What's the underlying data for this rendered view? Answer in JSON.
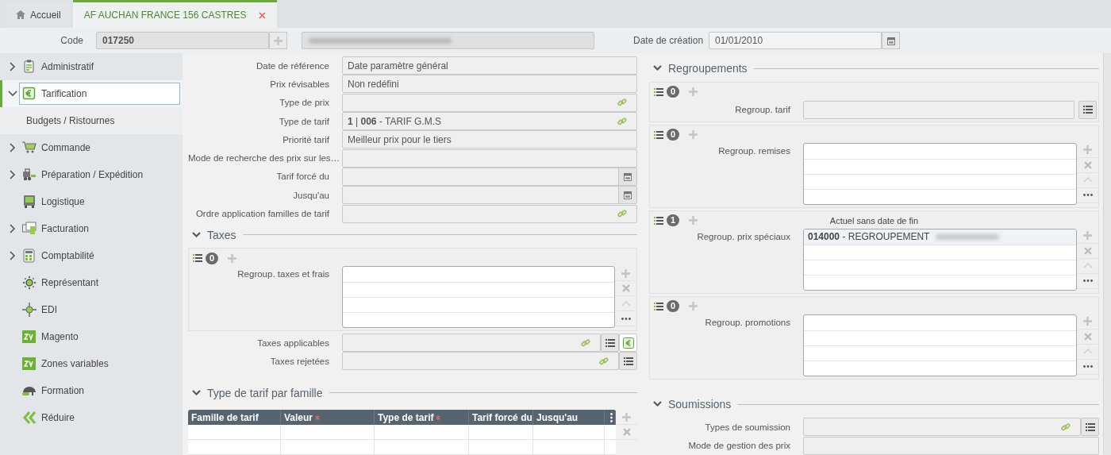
{
  "tabs": [
    {
      "label": "Accueil",
      "kind": "home",
      "selected": false,
      "closable": false
    },
    {
      "label": "AF AUCHAN FRANCE 156 CASTRES",
      "kind": "record",
      "selected": true,
      "closable": true
    }
  ],
  "header": {
    "code_label": "Code",
    "code_value": "017250",
    "name_redacted": true,
    "date_label": "Date de création",
    "date_value": "01/01/2010"
  },
  "sidebar": {
    "items": [
      {
        "label": "Administratif",
        "kind": "clipboard",
        "expanded": false,
        "selected": false
      },
      {
        "label": "Tarification",
        "kind": "euro",
        "expanded": true,
        "selected": true,
        "children": [
          {
            "label": "Budgets / Ristournes",
            "selected": false
          }
        ]
      },
      {
        "label": "Commande",
        "kind": "cart",
        "expanded": false,
        "selected": false
      },
      {
        "label": "Préparation / Expédition",
        "kind": "forklift",
        "expanded": false,
        "selected": false
      },
      {
        "label": "Logistique",
        "kind": "truck",
        "selected": false
      },
      {
        "label": "Facturation",
        "kind": "invoice",
        "expanded": false,
        "selected": false
      },
      {
        "label": "Comptabilité",
        "kind": "calculator",
        "expanded": false,
        "selected": false
      },
      {
        "label": "Représentant",
        "kind": "person",
        "selected": false
      },
      {
        "label": "EDI",
        "kind": "exchange",
        "selected": false
      },
      {
        "label": "Magento",
        "kind": "zv",
        "selected": false
      },
      {
        "label": "Zones variables",
        "kind": "zv",
        "selected": false
      },
      {
        "label": "Formation",
        "kind": "cap",
        "selected": false
      },
      {
        "label": "Réduire",
        "kind": "collapse",
        "selected": false
      }
    ]
  },
  "left_column": [
    {
      "kind": "fields",
      "fields": [
        {
          "label": "Date de référence",
          "kind": "text",
          "value": "Date paramètre général"
        },
        {
          "label": "Prix révisables",
          "kind": "text",
          "value": "Non redéfini"
        },
        {
          "label": "Type de prix",
          "kind": "link"
        },
        {
          "label": "Type de tarif",
          "kind": "link",
          "value": "**1** | **006** - TARIF G.M.S"
        },
        {
          "label": "Priorité tarif",
          "kind": "text",
          "value": "Meilleur prix pour le tiers"
        },
        {
          "label": "Mode de recherche des prix sur les…",
          "kind": "text"
        },
        {
          "label": "Tarif forcé du",
          "kind": "date"
        },
        {
          "label": "Jusqu'au",
          "kind": "date"
        },
        {
          "label": "Ordre application familles de tarif",
          "kind": "link"
        }
      ]
    },
    {
      "kind": "section",
      "title": "Taxes",
      "expanded": true
    },
    {
      "kind": "list_group",
      "count": "0",
      "label": "Regroup. taxes et frais"
    },
    {
      "kind": "fields",
      "fields": [
        {
          "label": "Taxes applicables",
          "kind": "link",
          "list_button": true,
          "euro_button": true
        },
        {
          "label": "Taxes rejetées",
          "kind": "link",
          "list_button": true,
          "euro_button": false
        }
      ]
    },
    {
      "kind": "section",
      "title": "Type de tarif par famille",
      "expanded": true
    },
    {
      "kind": "table",
      "columns": [
        {
          "label": "Famille de tarif",
          "required": false
        },
        {
          "label": "Valeur",
          "required": true
        },
        {
          "label": "Type de tarif",
          "required": true
        },
        {
          "label": "Tarif forcé du",
          "required": false
        },
        {
          "label": "Jusqu'au",
          "required": false
        }
      ]
    }
  ],
  "right_column": [
    {
      "kind": "section",
      "title": "Regroupements",
      "expanded": true
    },
    {
      "kind": "select_group",
      "count": "0",
      "label": "Regroup. tarif"
    },
    {
      "kind": "list_group",
      "count": "0",
      "label": "Regroup. remises"
    },
    {
      "kind": "list_group",
      "count": "1",
      "caption": "Actuel sans date de fin",
      "label": "Regroup. prix spéciaux",
      "items": [
        {
          "text": "**014000** - REGROUPEMENT",
          "redacted": true,
          "selected": true
        }
      ]
    },
    {
      "kind": "list_group",
      "count": "0",
      "label": "Regroup. promotions"
    },
    {
      "kind": "section",
      "title": "Soumissions",
      "expanded": true
    },
    {
      "kind": "fields",
      "fields": [
        {
          "label": "Types de soumission",
          "kind": "link",
          "list_button": true,
          "euro_button": false
        },
        {
          "label": "Mode de gestion des prix",
          "kind": "text"
        }
      ]
    }
  ]
}
